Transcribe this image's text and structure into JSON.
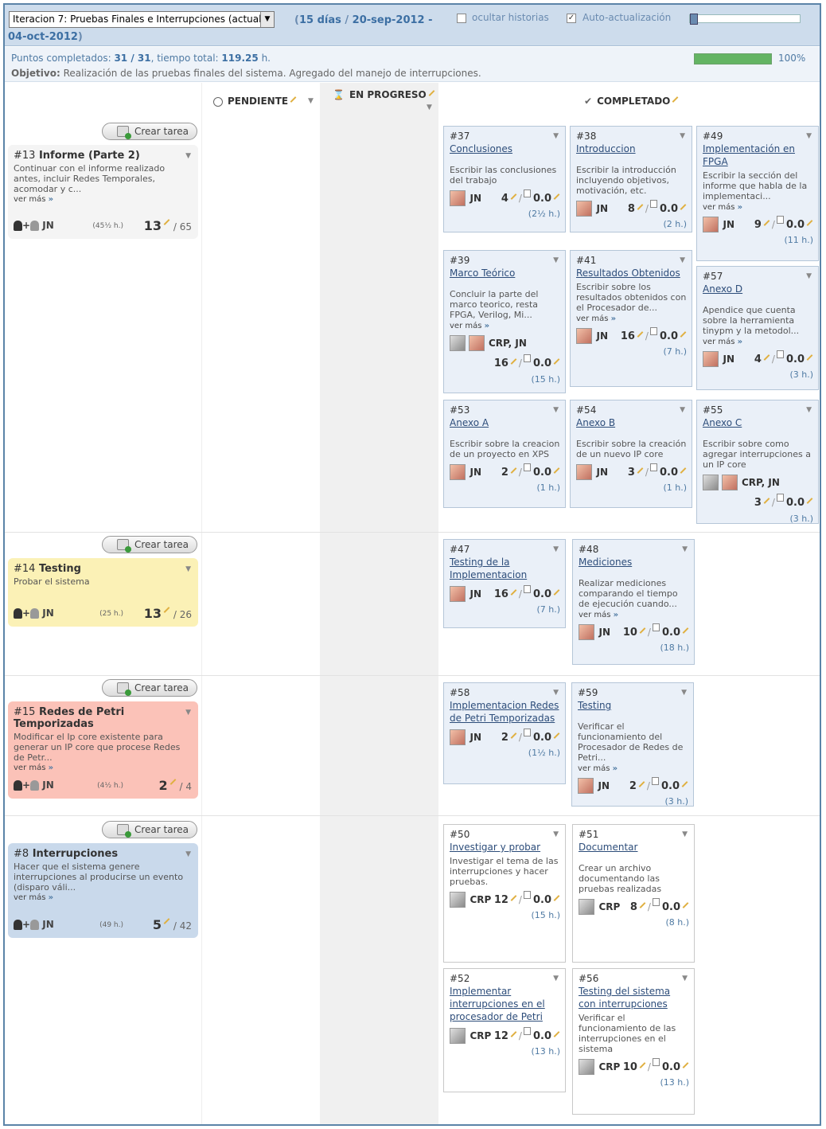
{
  "header": {
    "iteration_select": "Iteracion 7: Pruebas Finales e Interrupciones (actual)",
    "days": "15 días",
    "date_range": "20-sep-2012 - 04-oct-2012",
    "hide_stories_label": "ocultar historias",
    "auto_update_label": "Auto-actualización",
    "hide_stories_checked": false,
    "auto_update_checked": true
  },
  "info": {
    "points_label": "Puntos completados:",
    "points_value": "31 / 31",
    "time_label": ", tiempo total:",
    "time_value": "119.25",
    "time_unit": "h.",
    "objective_label": "Objetivo:",
    "objective_text": "Realización de las pruebas finales del sistema. Agregado del manejo de interrupciones.",
    "progress_percent": 100,
    "progress_label": "100%"
  },
  "columns": {
    "pending": "PENDIENTE",
    "in_progress": "EN PROGRESO",
    "done": "COMPLETADO"
  },
  "create_task_label": "Crear tarea",
  "more_label": "ver más",
  "more_arrow": "»",
  "stories": [
    {
      "num": "#13",
      "title": "Informe (Parte 2)",
      "desc": "Continuar con el informe realizado antes, incluir Redes Temporales, acomodar y c...",
      "has_more": true,
      "owners": "JN",
      "hours": "(45½ h.)",
      "done_points": "13",
      "total_points": "/ 65",
      "color": "#f4f4f4"
    },
    {
      "num": "#14",
      "title": "Testing",
      "desc": "Probar el sistema",
      "has_more": false,
      "owners": "JN",
      "hours": "(25 h.)",
      "done_points": "13",
      "total_points": "/ 26",
      "color": "#fbf1b6"
    },
    {
      "num": "#15",
      "title": "Redes de Petri Temporizadas",
      "desc": "Modificar el Ip core existente para generar un IP core que procese Redes de Petr...",
      "has_more": true,
      "owners": "JN",
      "hours": "(4½ h.)",
      "done_points": "2",
      "total_points": "/ 4",
      "color": "#fbc2b8"
    },
    {
      "num": "#8",
      "title": "Interrupciones",
      "desc": "Hacer que el sistema genere interrupciones al producirse un evento (disparo váli...",
      "has_more": true,
      "owners": "JN",
      "hours": "(49 h.)",
      "done_points": "5",
      "total_points": "/ 42",
      "color": "#c9d9eb"
    }
  ],
  "tasks": [
    {
      "num": "#37",
      "title": "Conclusiones",
      "desc": "Escribir las conclusiones del trabajo",
      "more": false,
      "users": "JN",
      "avatars": [
        "p"
      ],
      "points": "4",
      "remaining": "0.0",
      "hours": "(2½ h.)",
      "style": "blue"
    },
    {
      "num": "#38",
      "title": "Introduccion",
      "desc": "Escribir la introducción incluyendo objetivos, motivación, etc.",
      "more": false,
      "users": "JN",
      "avatars": [
        "p"
      ],
      "points": "8",
      "remaining": "0.0",
      "hours": "(2 h.)",
      "style": "blue"
    },
    {
      "num": "#49",
      "title": "Implementación en FPGA",
      "desc": "Escribir la sección del informe que habla de la implementaci...",
      "more": true,
      "users": "JN",
      "avatars": [
        "p"
      ],
      "points": "9",
      "remaining": "0.0",
      "hours": "(11 h.)",
      "style": "blue"
    },
    {
      "num": "#39",
      "title": "Marco Teórico",
      "desc": "Concluir la parte del marco teorico, resta FPGA, Verilog, Mi...",
      "more": true,
      "users": "CRP, JN",
      "avatars": [
        "g",
        "p"
      ],
      "points": "16",
      "remaining": "0.0",
      "hours": "(15 h.)",
      "style": "blue"
    },
    {
      "num": "#41",
      "title": "Resultados Obtenidos",
      "desc": "Escribir sobre los resultados obtenidos con el Procesador de...",
      "more": true,
      "users": "JN",
      "avatars": [
        "p"
      ],
      "points": "16",
      "remaining": "0.0",
      "hours": "(7 h.)",
      "style": "blue"
    },
    {
      "num": "#57",
      "title": "Anexo D",
      "desc": "Apendice que cuenta sobre la herramienta tinypm y la metodol...",
      "more": true,
      "users": "JN",
      "avatars": [
        "p"
      ],
      "points": "4",
      "remaining": "0.0",
      "hours": "(3 h.)",
      "style": "blue"
    },
    {
      "num": "#53",
      "title": "Anexo A",
      "desc": "Escribir sobre la creacion de un proyecto en XPS",
      "more": false,
      "users": "JN",
      "avatars": [
        "p"
      ],
      "points": "2",
      "remaining": "0.0",
      "hours": "(1 h.)",
      "style": "blue"
    },
    {
      "num": "#54",
      "title": "Anexo B",
      "desc": "Escribir sobre la creación de un nuevo IP core",
      "more": false,
      "users": "JN",
      "avatars": [
        "p"
      ],
      "points": "3",
      "remaining": "0.0",
      "hours": "(1 h.)",
      "style": "blue"
    },
    {
      "num": "#55",
      "title": "Anexo C",
      "desc": "Escribir sobre como agregar interrupciones a un IP core",
      "more": false,
      "users": "CRP, JN",
      "avatars": [
        "g",
        "p"
      ],
      "points": "3",
      "remaining": "0.0",
      "hours": "(3 h.)",
      "style": "blue"
    },
    {
      "num": "#47",
      "title": "Testing de la Implementacion",
      "desc": "",
      "more": false,
      "users": "JN",
      "avatars": [
        "p"
      ],
      "points": "16",
      "remaining": "0.0",
      "hours": "(7 h.)",
      "style": "blue"
    },
    {
      "num": "#48",
      "title": "Mediciones",
      "desc": "Realizar mediciones comparando el tiempo de ejecución cuando...",
      "more": true,
      "users": "JN",
      "avatars": [
        "p"
      ],
      "points": "10",
      "remaining": "0.0",
      "hours": "(18 h.)",
      "style": "blue"
    },
    {
      "num": "#58",
      "title": "Implementacion Redes de Petri Temporizadas",
      "desc": "",
      "more": false,
      "users": "JN",
      "avatars": [
        "p"
      ],
      "points": "2",
      "remaining": "0.0",
      "hours": "(1½ h.)",
      "style": "blue"
    },
    {
      "num": "#59",
      "title": "Testing",
      "desc": "Verificar el funcionamiento del Procesador de Redes de Petri...",
      "more": true,
      "users": "JN",
      "avatars": [
        "p"
      ],
      "points": "2",
      "remaining": "0.0",
      "hours": "(3 h.)",
      "style": "blue"
    },
    {
      "num": "#50",
      "title": "Investigar y probar",
      "desc": "Investigar el tema de las interrupciones y hacer pruebas.",
      "more": false,
      "users": "CRP",
      "avatars": [
        "g"
      ],
      "points": "12",
      "remaining": "0.0",
      "hours": "(15 h.)",
      "style": "white"
    },
    {
      "num": "#51",
      "title": "Documentar",
      "desc": "Crear un archivo documentando las pruebas realizadas",
      "more": false,
      "users": "CRP",
      "avatars": [
        "g"
      ],
      "points": "8",
      "remaining": "0.0",
      "hours": "(8 h.)",
      "style": "white"
    },
    {
      "num": "#52",
      "title": "Implementar interrupciones en el procesador de Petri",
      "desc": "",
      "more": false,
      "users": "CRP",
      "avatars": [
        "g"
      ],
      "points": "12",
      "remaining": "0.0",
      "hours": "(13 h.)",
      "style": "white"
    },
    {
      "num": "#56",
      "title": "Testing del sistema con interrupciones",
      "desc": "Verificar el funcionamiento de las interrupciones en el sistema",
      "more": false,
      "users": "CRP",
      "avatars": [
        "g"
      ],
      "points": "10",
      "remaining": "0.0",
      "hours": "(13 h.)",
      "style": "white"
    }
  ]
}
